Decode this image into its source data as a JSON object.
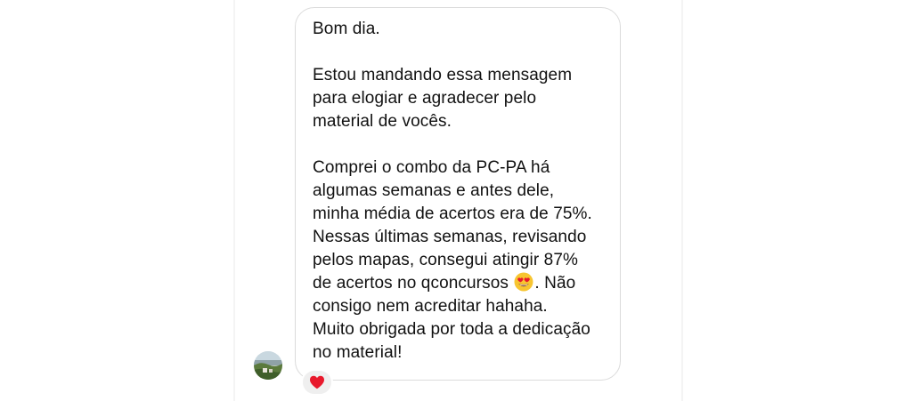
{
  "message": {
    "lines": [
      "Bom dia.",
      "",
      "Estou mandando essa mensagem",
      "para elogiar e agradecer pelo",
      "material de vocês.",
      "",
      "Comprei o combo da PC-PA há",
      "algumas semanas e antes dele,",
      "minha média de acertos era de 75%.",
      "Nessas últimas semanas, revisando",
      "pelos mapas, consegui atingir 87%",
      "de acertos no qconcursos",
      ". Não",
      "consigo nem acreditar hahaha.",
      "Muito obrigada por toda a dedicação",
      "no material!"
    ],
    "emoji": "heart-eyes-emoji"
  },
  "reaction": {
    "icon": "red-heart-icon",
    "color": "#e8192c"
  },
  "avatar": {
    "icon": "landscape-avatar"
  },
  "colors": {
    "bubble_border": "#dbdbdb",
    "text": "#111111",
    "reaction_bg": "#efefef"
  }
}
